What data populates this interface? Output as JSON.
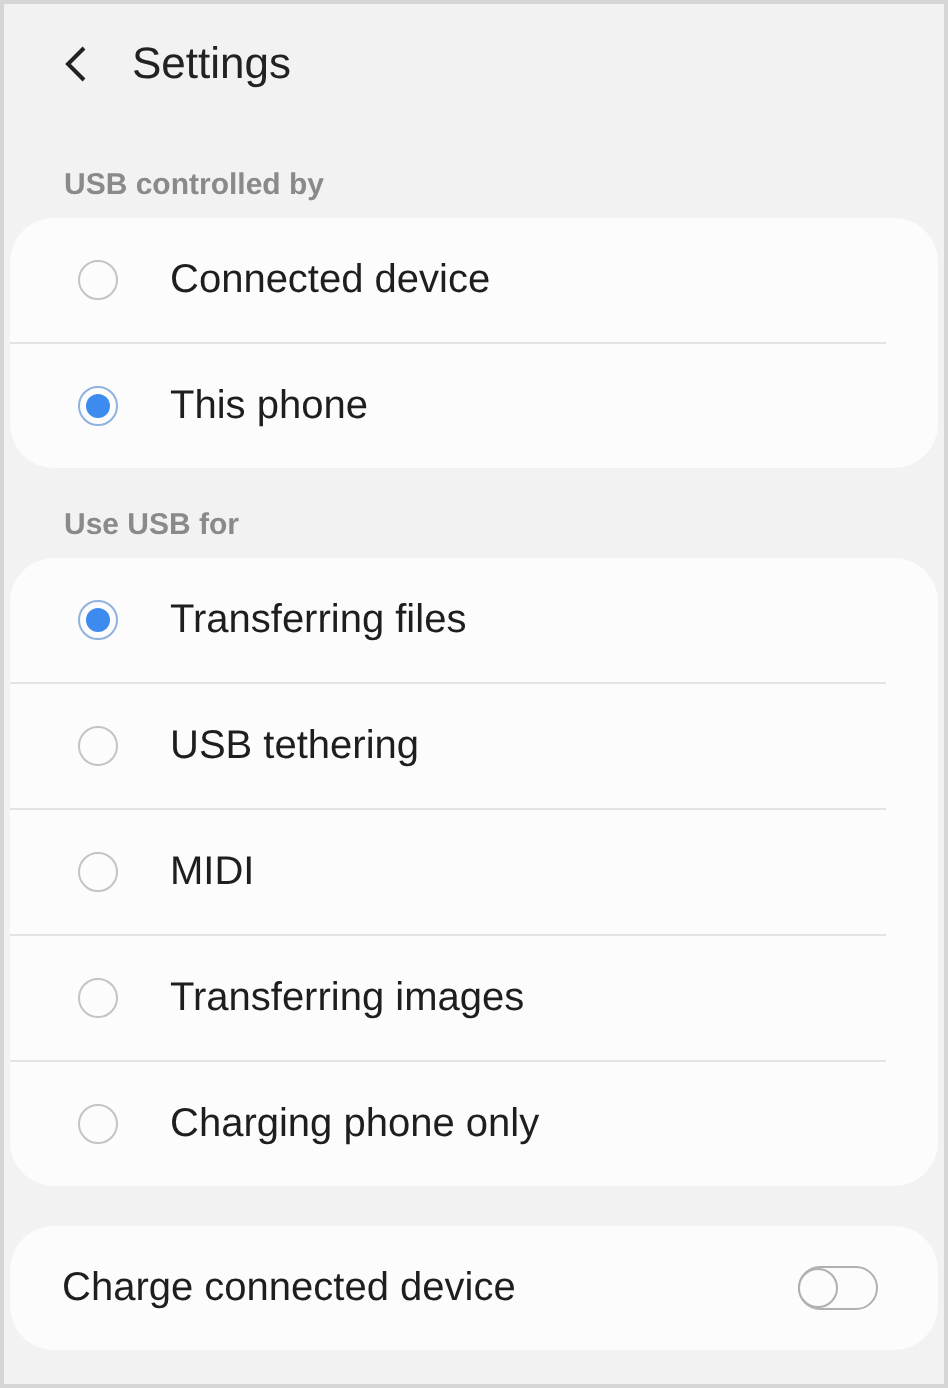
{
  "header": {
    "title": "Settings"
  },
  "sections": [
    {
      "label": "USB controlled by",
      "options": [
        {
          "label": "Connected device",
          "selected": false
        },
        {
          "label": "This phone",
          "selected": true
        }
      ]
    },
    {
      "label": "Use USB for",
      "options": [
        {
          "label": "Transferring files",
          "selected": true
        },
        {
          "label": "USB tethering",
          "selected": false
        },
        {
          "label": "MIDI",
          "selected": false
        },
        {
          "label": "Transferring images",
          "selected": false
        },
        {
          "label": "Charging phone only",
          "selected": false
        }
      ]
    }
  ],
  "toggle": {
    "label": "Charge connected device",
    "on": false
  }
}
